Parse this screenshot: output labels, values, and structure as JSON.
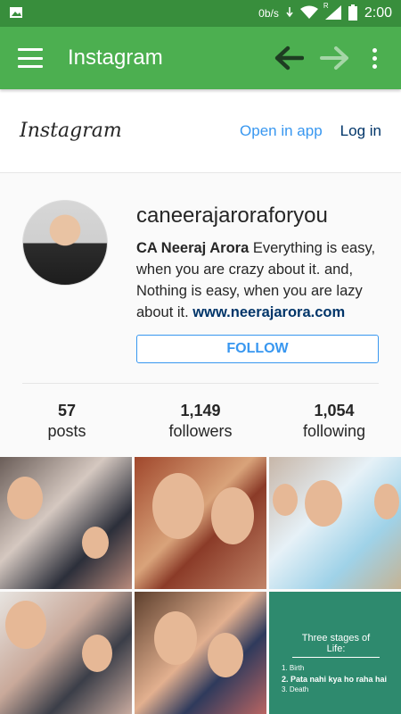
{
  "statusbar": {
    "speed": "0b/s",
    "signal_letter": "R",
    "time": "2:00"
  },
  "appbar": {
    "title": "Instagram"
  },
  "ig_header": {
    "logo": "Instagram",
    "open_in_app": "Open in app",
    "log_in": "Log in"
  },
  "profile": {
    "username": "caneerajaroraforyou",
    "bio_name": "CA Neeraj Arora",
    "bio_text": " Everything is easy, when you are crazy about it. and, Nothing is easy, when you are lazy about it. ",
    "bio_link": "www.neerajarora.com",
    "follow_label": "FOLLOW"
  },
  "stats": [
    {
      "num": "57",
      "label": "posts"
    },
    {
      "num": "1,149",
      "label": "followers"
    },
    {
      "num": "1,054",
      "label": "following"
    }
  ],
  "posts": {
    "quote_title": "Three stages of Life:",
    "lines": [
      "1. Birth",
      "2. Pata nahi kya ho raha hai",
      "3. Death"
    ]
  },
  "colors": {
    "appbar": "#4caf50",
    "statusbar": "#388e3c",
    "link": "#3897f0",
    "dark_link": "#003569"
  },
  "icons": [
    "image-icon",
    "download-icon",
    "wifi-icon",
    "signal-icon",
    "battery-icon",
    "menu-icon",
    "back-arrow-icon",
    "forward-arrow-icon",
    "more-vert-icon"
  ]
}
